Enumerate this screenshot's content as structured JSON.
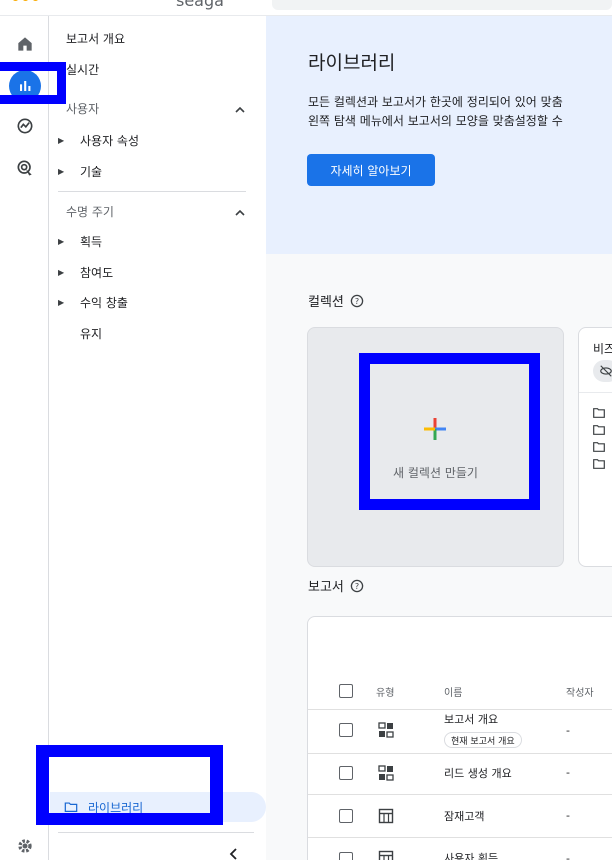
{
  "app": {
    "account_name": "seaga"
  },
  "nav": {
    "overview": "보고서 개요",
    "realtime": "실시간",
    "section_user": "사용자",
    "user_items": [
      "사용자 속성",
      "기술"
    ],
    "section_lifecycle": "수명 주기",
    "lifecycle_items": [
      "획득",
      "참여도",
      "수익 창출"
    ],
    "retention": "유지",
    "library": "라이브러리"
  },
  "hero": {
    "title": "라이브러리",
    "desc_line1": "모든 컬렉션과 보고서가 한곳에 정리되어 있어 맞춤",
    "desc_line2": "왼쪽 탐색 메뉴에서 보고서의 모양을 맞춤설정할 수",
    "learn_more": "자세히 알아보기"
  },
  "collections": {
    "label": "컬렉션",
    "new_collection": "새 컬렉션 만들기",
    "card_title": "비즈"
  },
  "reports": {
    "label": "보고서",
    "columns": {
      "type": "유형",
      "name": "이름",
      "creator": "작성자"
    },
    "rows": [
      {
        "name": "보고서 개요",
        "chip": "현재 보고서 개요",
        "creator": "-",
        "type": "dashboard-icon"
      },
      {
        "name": "리드 생성 개요",
        "creator": "-",
        "type": "dashboard-icon"
      },
      {
        "name": "잠재고객",
        "creator": "-",
        "type": "table-icon"
      },
      {
        "name": "사용자 획득",
        "creator": "-",
        "type": "table-icon"
      }
    ]
  },
  "colors": {
    "accent": "#1a73e8",
    "annotation": "#0000ff",
    "hero_bg": "#e8f0fe"
  }
}
